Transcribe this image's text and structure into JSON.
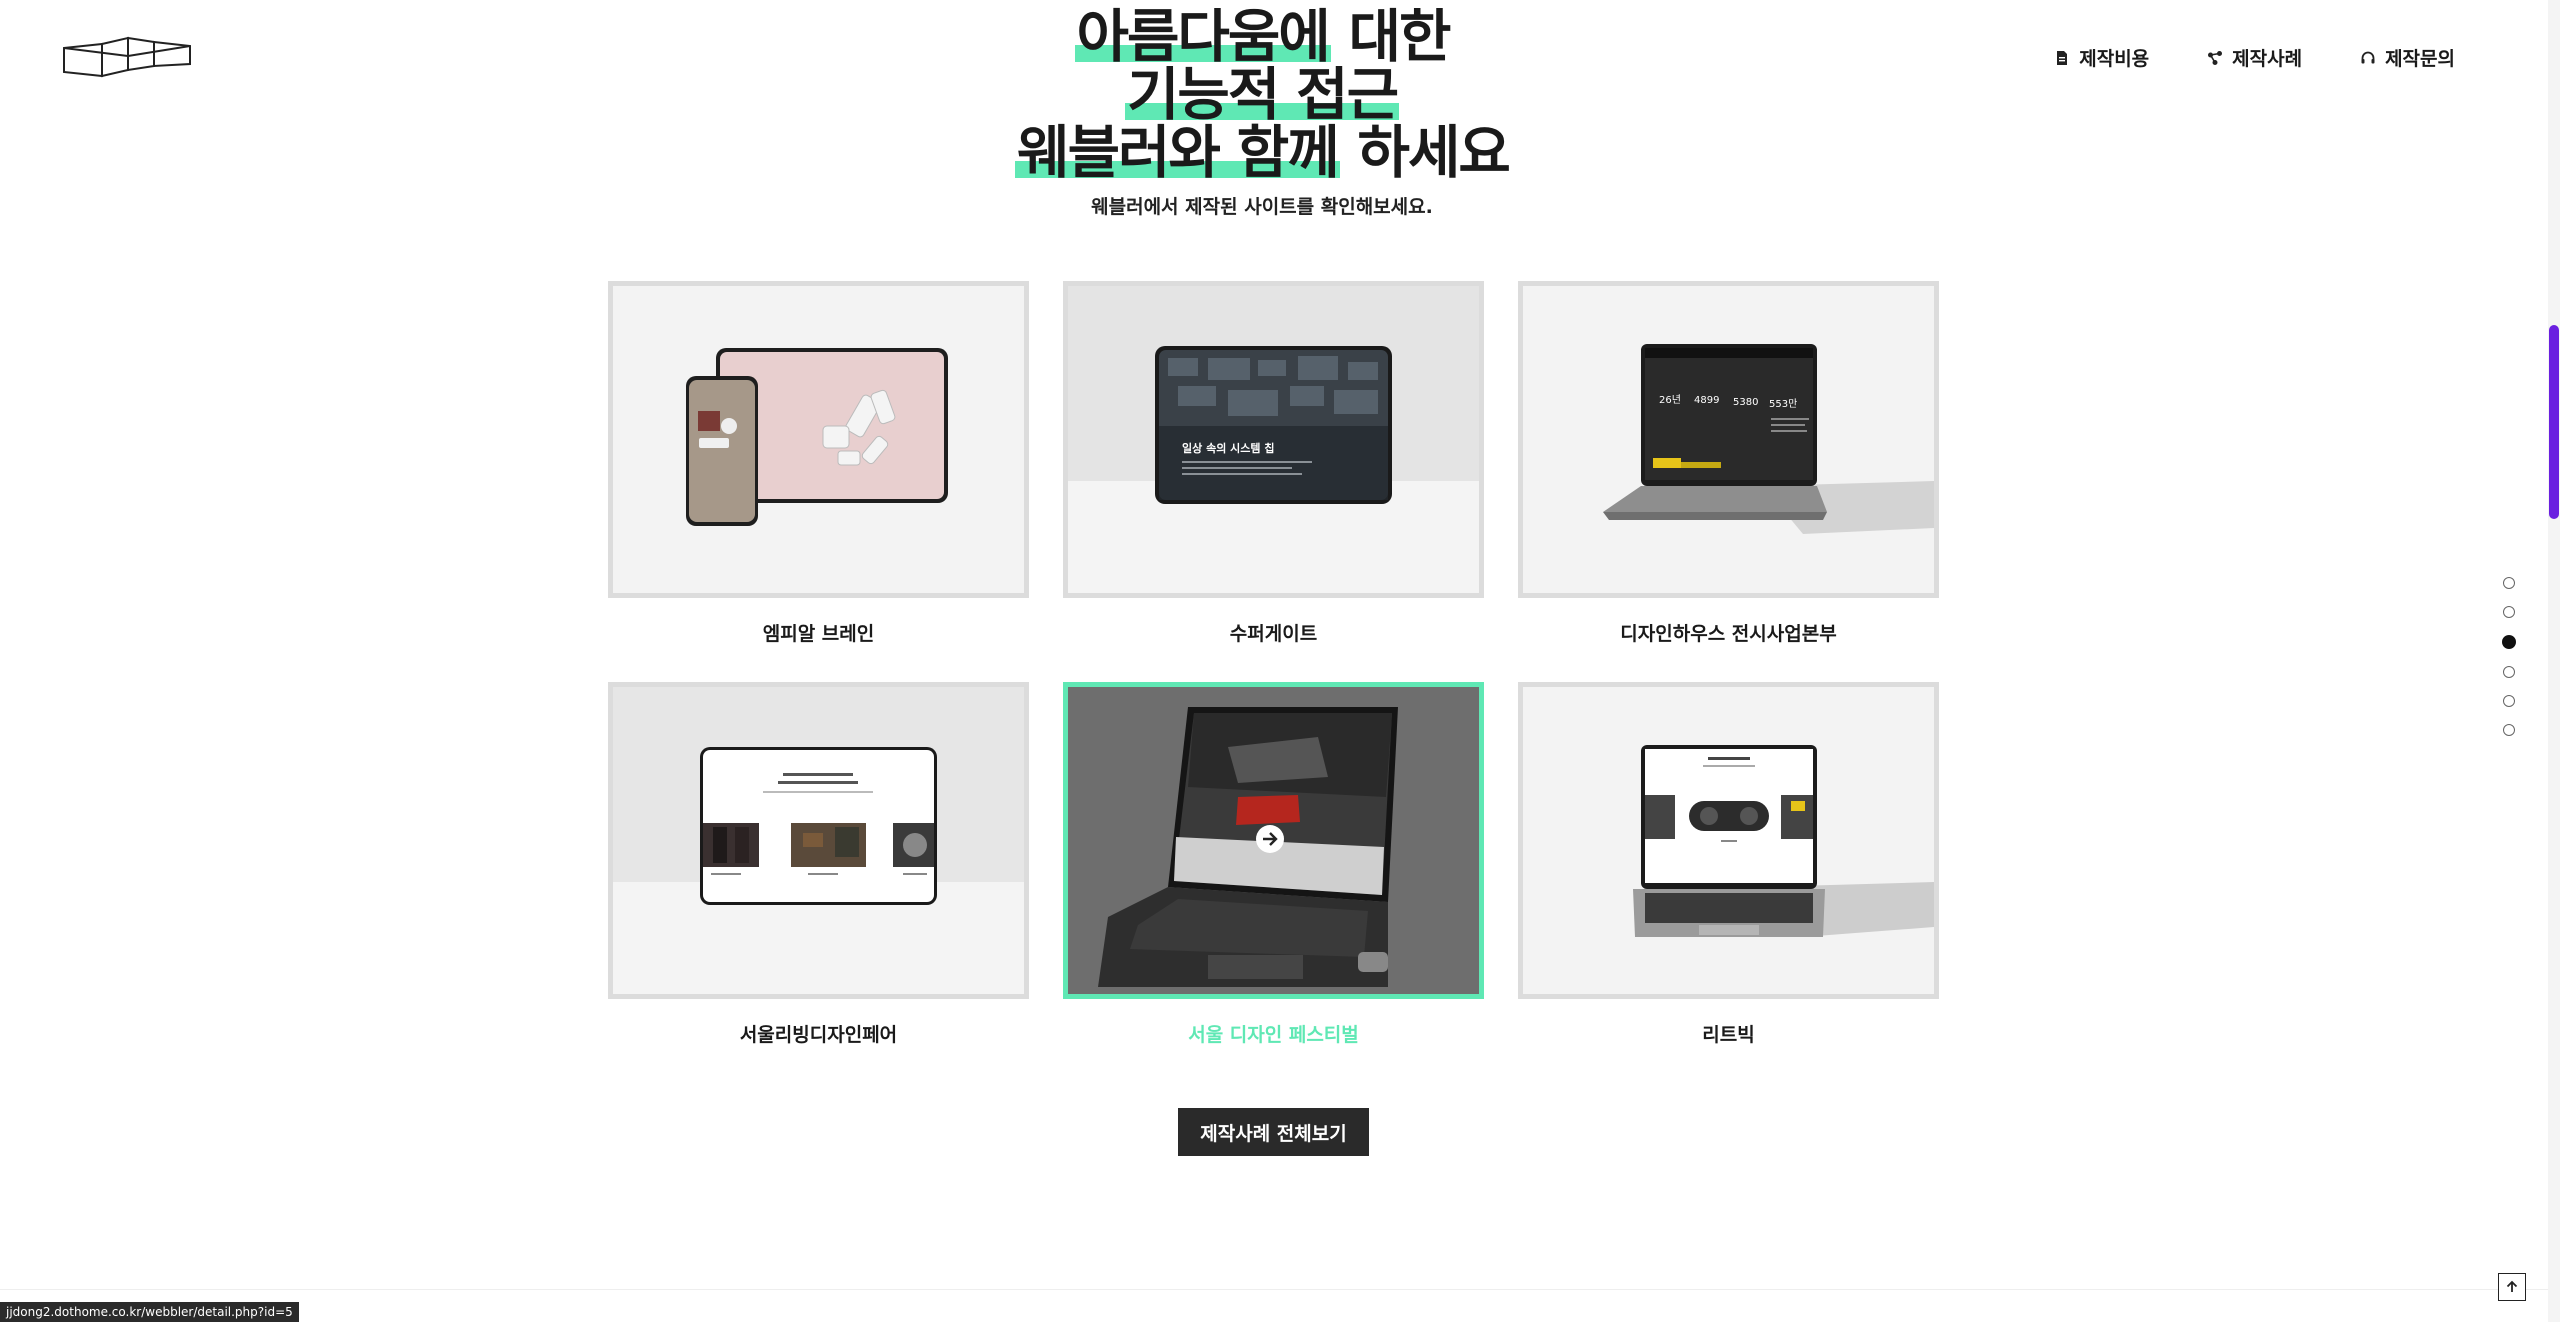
{
  "nav": {
    "items": [
      {
        "label": "제작비용",
        "icon": "document-icon"
      },
      {
        "label": "제작사례",
        "icon": "share-nodes-icon"
      },
      {
        "label": "제작문의",
        "icon": "headset-icon"
      }
    ]
  },
  "hero": {
    "line1_highlight": "아름다움에",
    "line1_rest": " 대한",
    "line2_highlight": "기능적 접근",
    "line3_highlight": "웨블러와 함께",
    "line3_rest": " 하세요",
    "subtitle": "웨블러에서 제작된 사이트를 확인해보세요."
  },
  "portfolio": {
    "items": [
      {
        "label": "엠피알 브레인",
        "screen_text": "",
        "active": false
      },
      {
        "label": "수퍼게이트",
        "screen_text": "일상 속의 시스템 칩",
        "active": false
      },
      {
        "label": "디자인하우스 전시사업본부",
        "screen_numbers": [
          "26년",
          "4899",
          "5380",
          "553만"
        ],
        "active": false
      },
      {
        "label": "서울리빙디자인페어",
        "active": false
      },
      {
        "label": "서울 디자인 페스티벌",
        "active": true
      },
      {
        "label": "리트빅",
        "active": false
      }
    ]
  },
  "buttons": {
    "view_all": "제작사례 전체보기"
  },
  "side_nav": {
    "count": 6,
    "active_index": 2
  },
  "status_bar": {
    "url": "jjdong2.dothome.co.kr/webbler/detail.php?id=5"
  },
  "colors": {
    "accent": "#5fe8b4",
    "dark": "#2a2a2a",
    "scroll_thumb": "#6a1fe0"
  }
}
